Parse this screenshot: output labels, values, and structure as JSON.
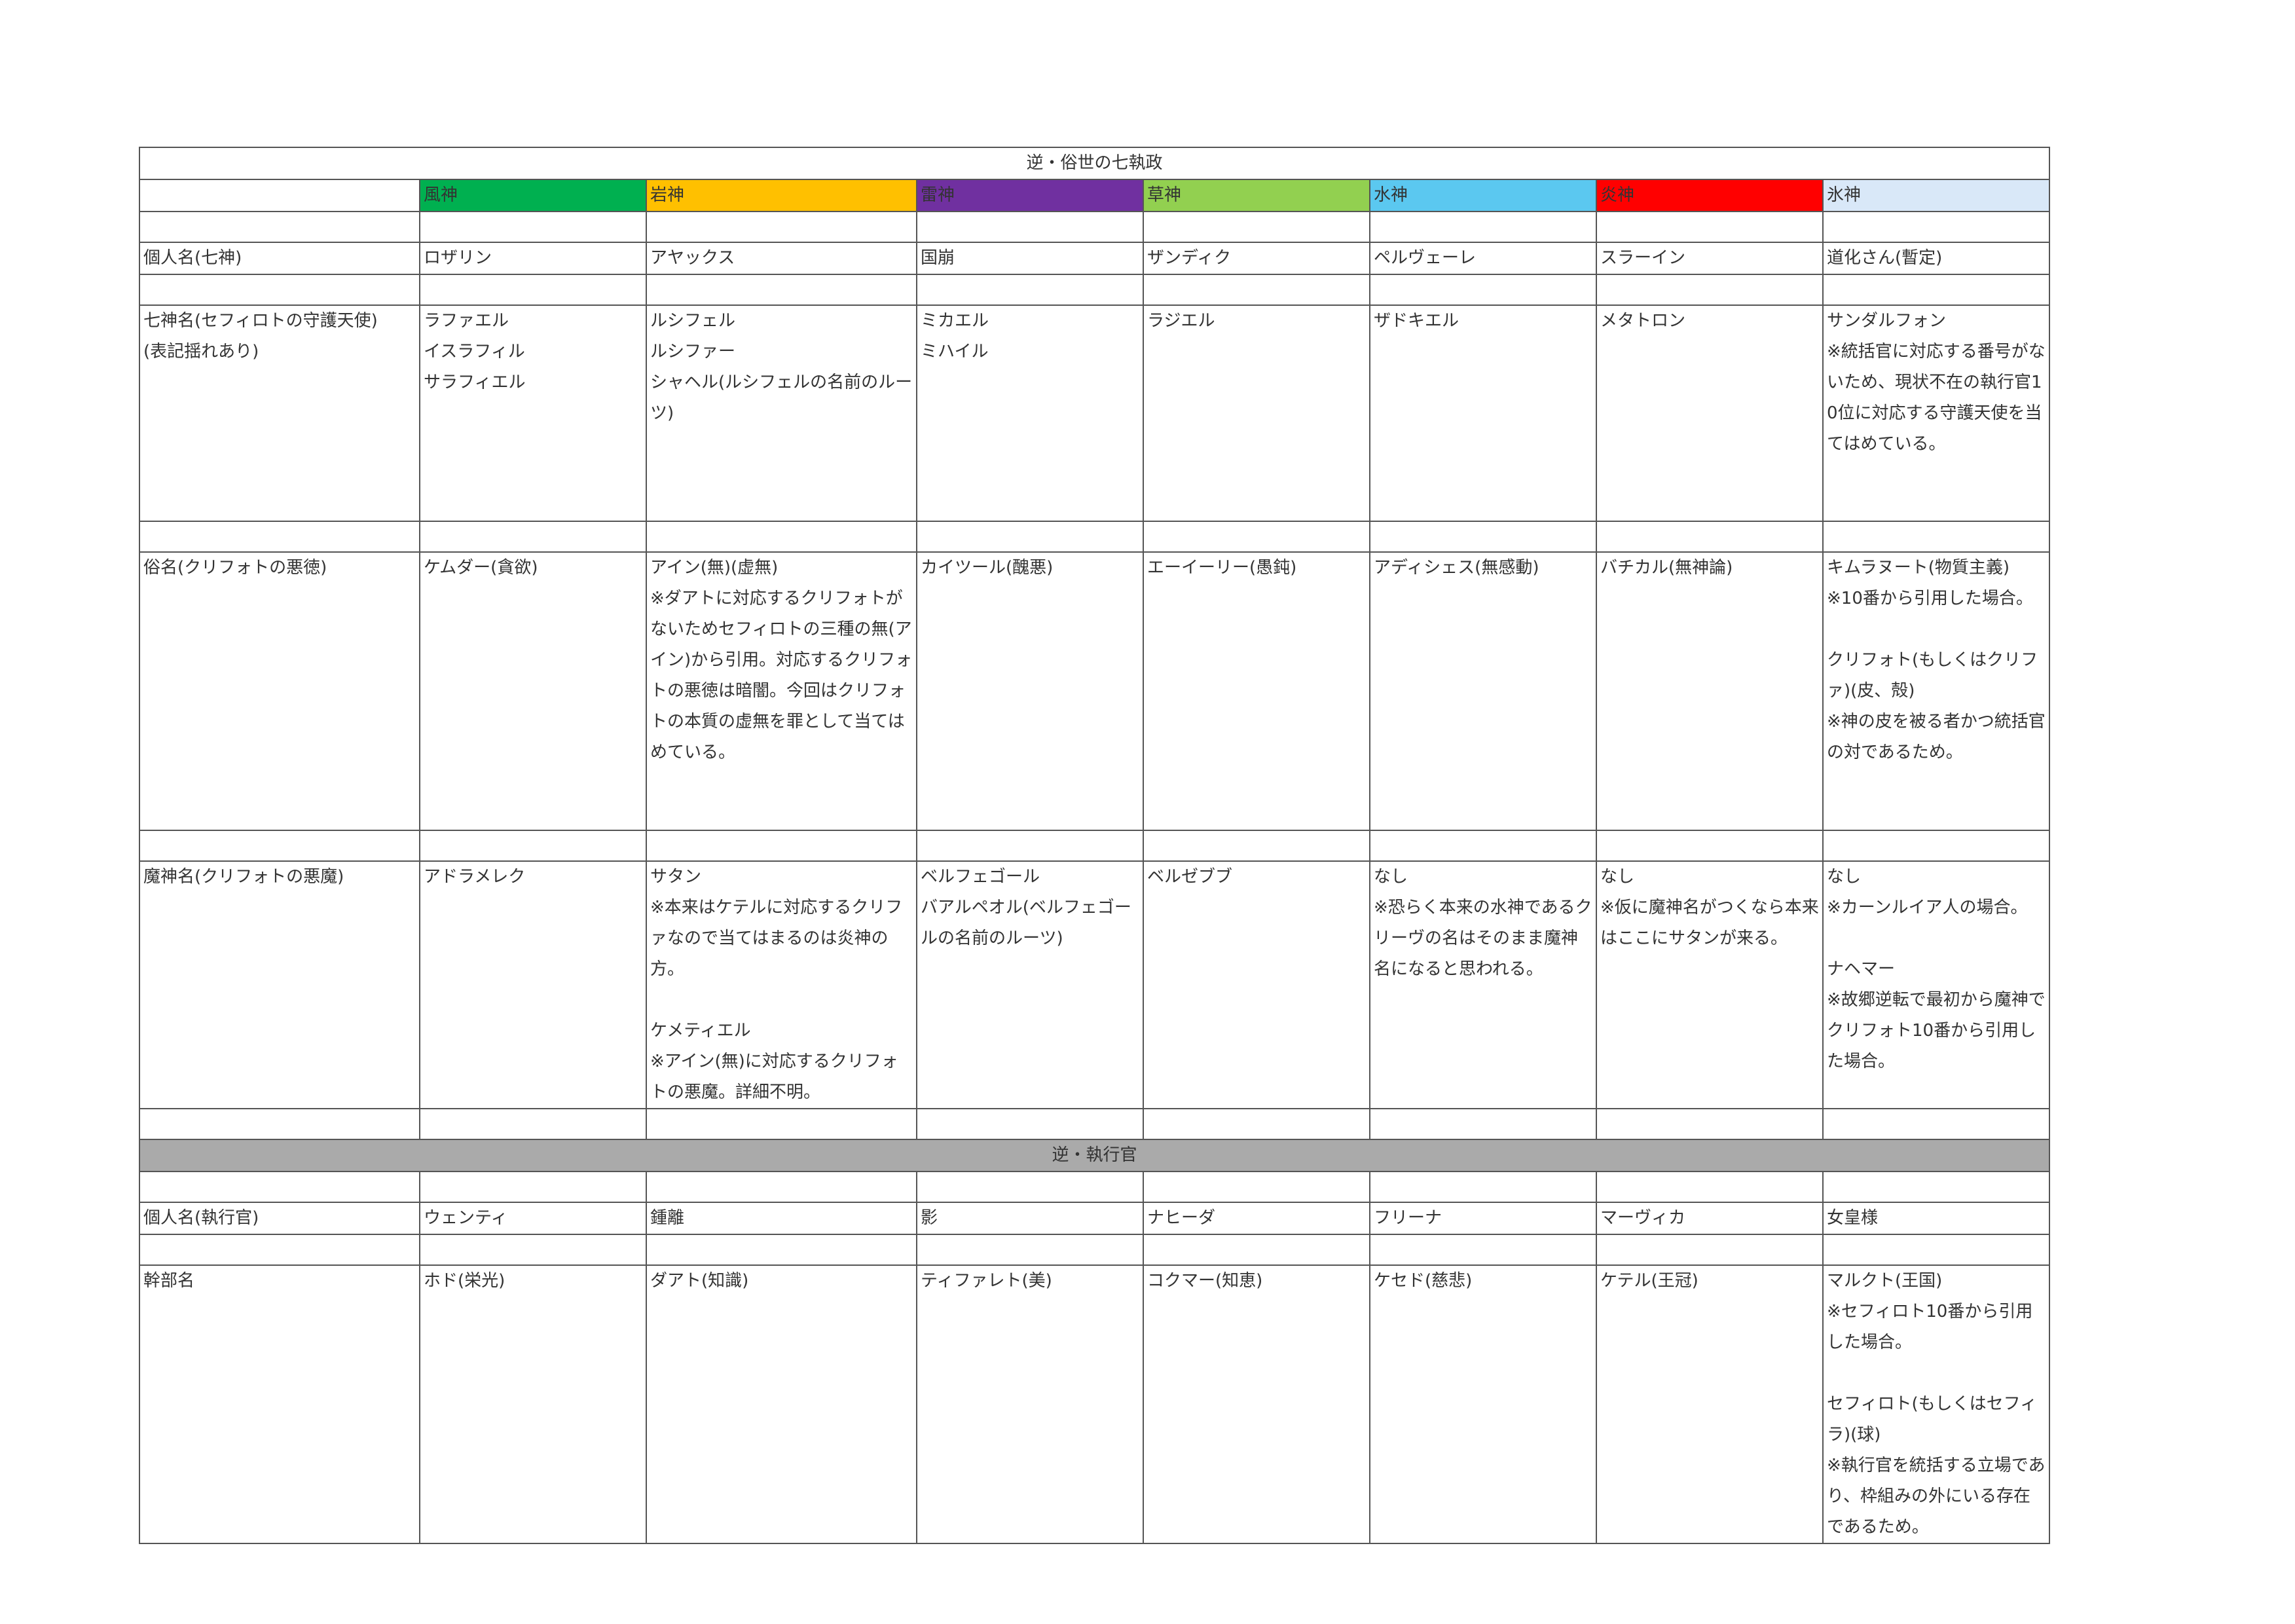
{
  "section1": {
    "title": "逆・俗世の七執政",
    "elements": [
      "風神",
      "岩神",
      "雷神",
      "草神",
      "水神",
      "炎神",
      "氷神"
    ],
    "element_colors": [
      "#00b050",
      "#ffc000",
      "#7030a0",
      "#92d050",
      "#5bc8f0",
      "#ff0000",
      "#d9e8f8"
    ],
    "rows": [
      {
        "label": "個人名(七神)",
        "cells": [
          "ロザリン",
          "アヤックス",
          "国崩",
          "ザンディク",
          "ペルヴェーレ",
          "スラーイン",
          "道化さん(暫定)"
        ]
      },
      {
        "label": "七神名(セフィロトの守護天使)\n(表記揺れあり)",
        "cells": [
          "ラファエル\nイスラフィル\nサラフィエル",
          "ルシフェル\nルシファー\nシャヘル(ルシフェルの名前のルーツ)",
          "ミカエル\nミハイル",
          "ラジエル",
          "ザドキエル",
          "メタトロン",
          "サンダルフォン\n※統括官に対応する番号がないため、現状不在の執行官10位に対応する守護天使を当てはめている。"
        ]
      },
      {
        "label": "俗名(クリフォトの悪徳)",
        "cells": [
          "ケムダー(貪欲)",
          "アイン(無)(虚無)\n※ダアトに対応するクリフォトがないためセフィロトの三種の無(アイン)から引用。対応するクリフォトの悪徳は暗闇。今回はクリフォトの本質の虚無を罪として当てはめている。",
          "カイツール(醜悪)",
          "エーイーリー(愚鈍)",
          "アディシェス(無感動)",
          "バチカル(無神論)",
          "キムラヌート(物質主義)\n※10番から引用した場合。\n\nクリフォト(もしくはクリファ)(皮、殻)\n※神の皮を被る者かつ統括官の対であるため。"
        ]
      },
      {
        "label": "魔神名(クリフォトの悪魔)",
        "cells": [
          "アドラメレク",
          "サタン\n※本来はケテルに対応するクリファなので当てはまるのは炎神の方。\n\nケメティエル\n※アイン(無)に対応するクリフォトの悪魔。詳細不明。",
          "ベルフェゴール\nバアルペオル(ベルフェゴールの名前のルーツ)",
          "ベルゼブブ",
          "なし\n※恐らく本来の水神であるクリーヴの名はそのまま魔神名になると思われる。",
          "なし\n※仮に魔神名がつくなら本来はここにサタンが来る。",
          "なし\n※カーンルイア人の場合。\n\nナヘマー\n※故郷逆転で最初から魔神でクリフォト10番から引用した場合。"
        ]
      }
    ]
  },
  "section2": {
    "title": "逆・執行官",
    "rows": [
      {
        "label": "個人名(執行官)",
        "cells": [
          "ウェンティ",
          "鍾離",
          "影",
          "ナヒーダ",
          "フリーナ",
          "マーヴィカ",
          "女皇様"
        ]
      },
      {
        "label": "幹部名",
        "cells": [
          "ホド(栄光)",
          "ダアト(知識)",
          "ティファレト(美)",
          "コクマー(知恵)",
          "ケセド(慈悲)",
          "ケテル(王冠)",
          "マルクト(王国)\n※セフィロト10番から引用した場合。\n\nセフィロト(もしくはセフィラ)(球)\n※執行官を統括する立場であり、枠組みの外にいる存在であるため。"
        ]
      }
    ]
  }
}
